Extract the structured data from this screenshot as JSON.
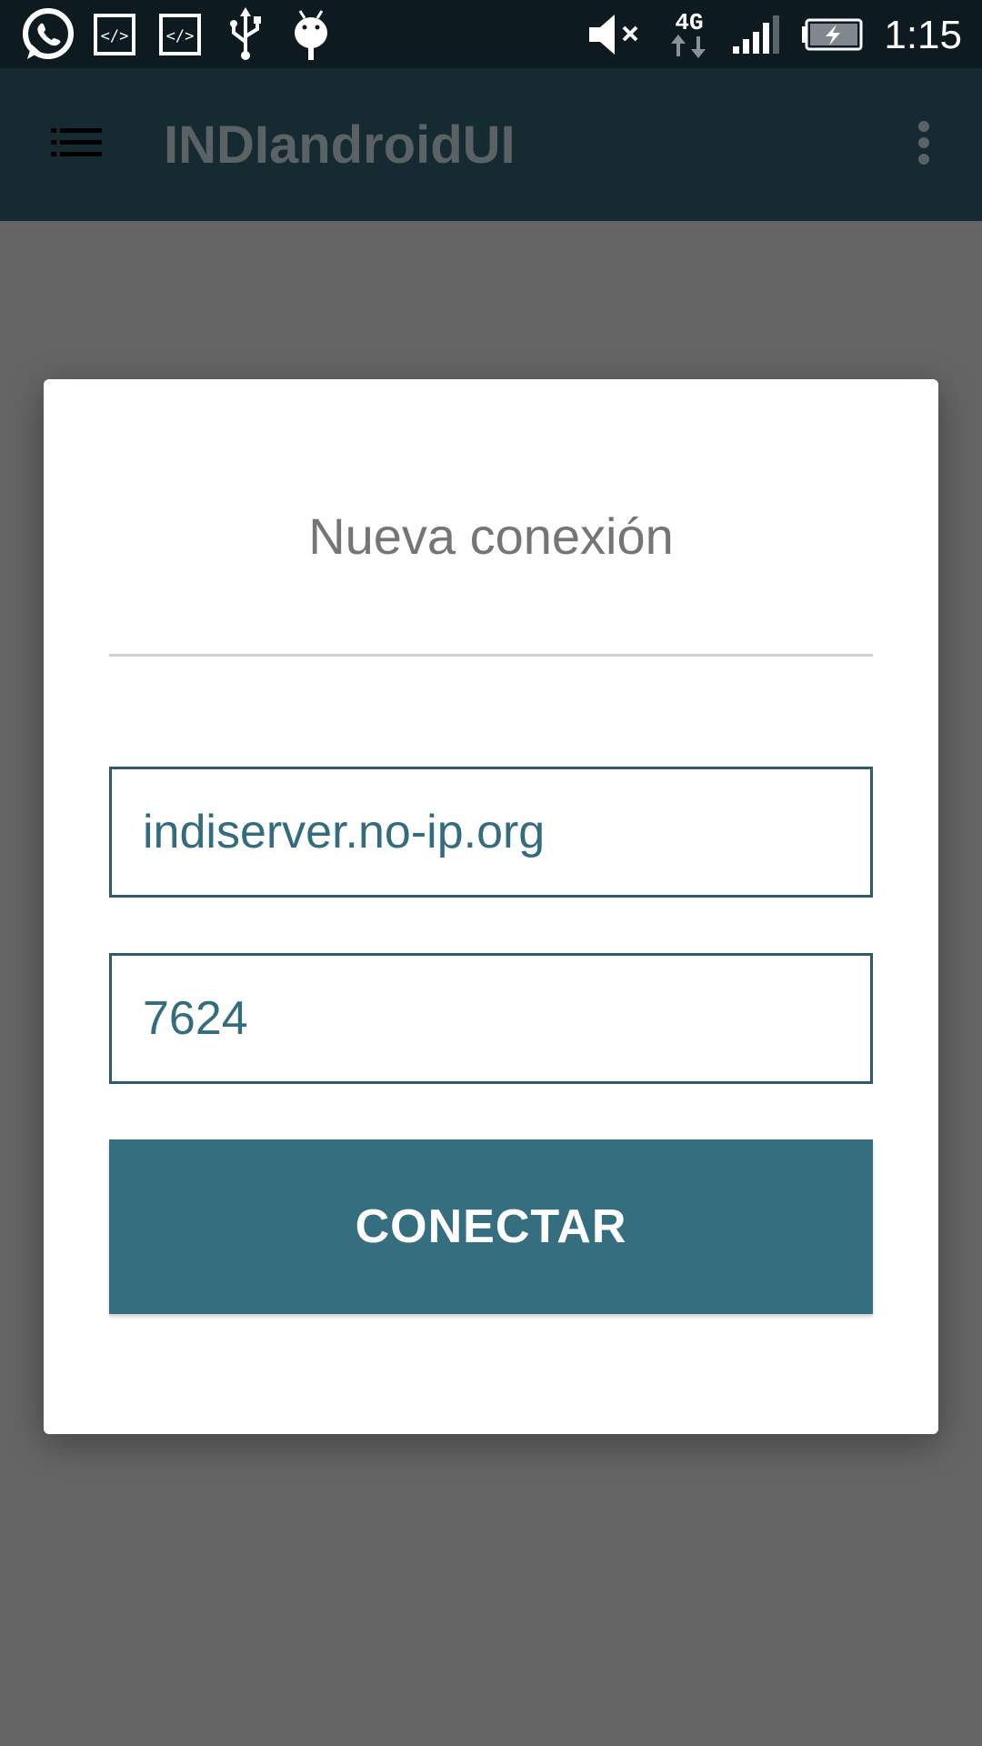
{
  "status_bar": {
    "time": "1:15",
    "network_label": "4G",
    "icons": [
      "whatsapp-icon",
      "code-icon",
      "code-icon",
      "usb-icon",
      "android-icon",
      "mute-icon",
      "network-4g-icon",
      "signal-icon",
      "battery-charging-icon"
    ]
  },
  "app_bar": {
    "title": "INDIandroidUI",
    "menu_icon": "list-menu-icon",
    "overflow_icon": "more-vert-icon"
  },
  "dialog": {
    "title": "Nueva conexión",
    "host_value": "indiserver.no-ip.org",
    "port_value": "7624",
    "connect_label": "CONECTAR"
  },
  "colors": {
    "status_bar": "#0d1b20",
    "app_bar": "#162a31",
    "scrim": "#656565",
    "accent": "#356e7e",
    "input_text": "#336c7e",
    "input_border": "#2f5b68"
  }
}
